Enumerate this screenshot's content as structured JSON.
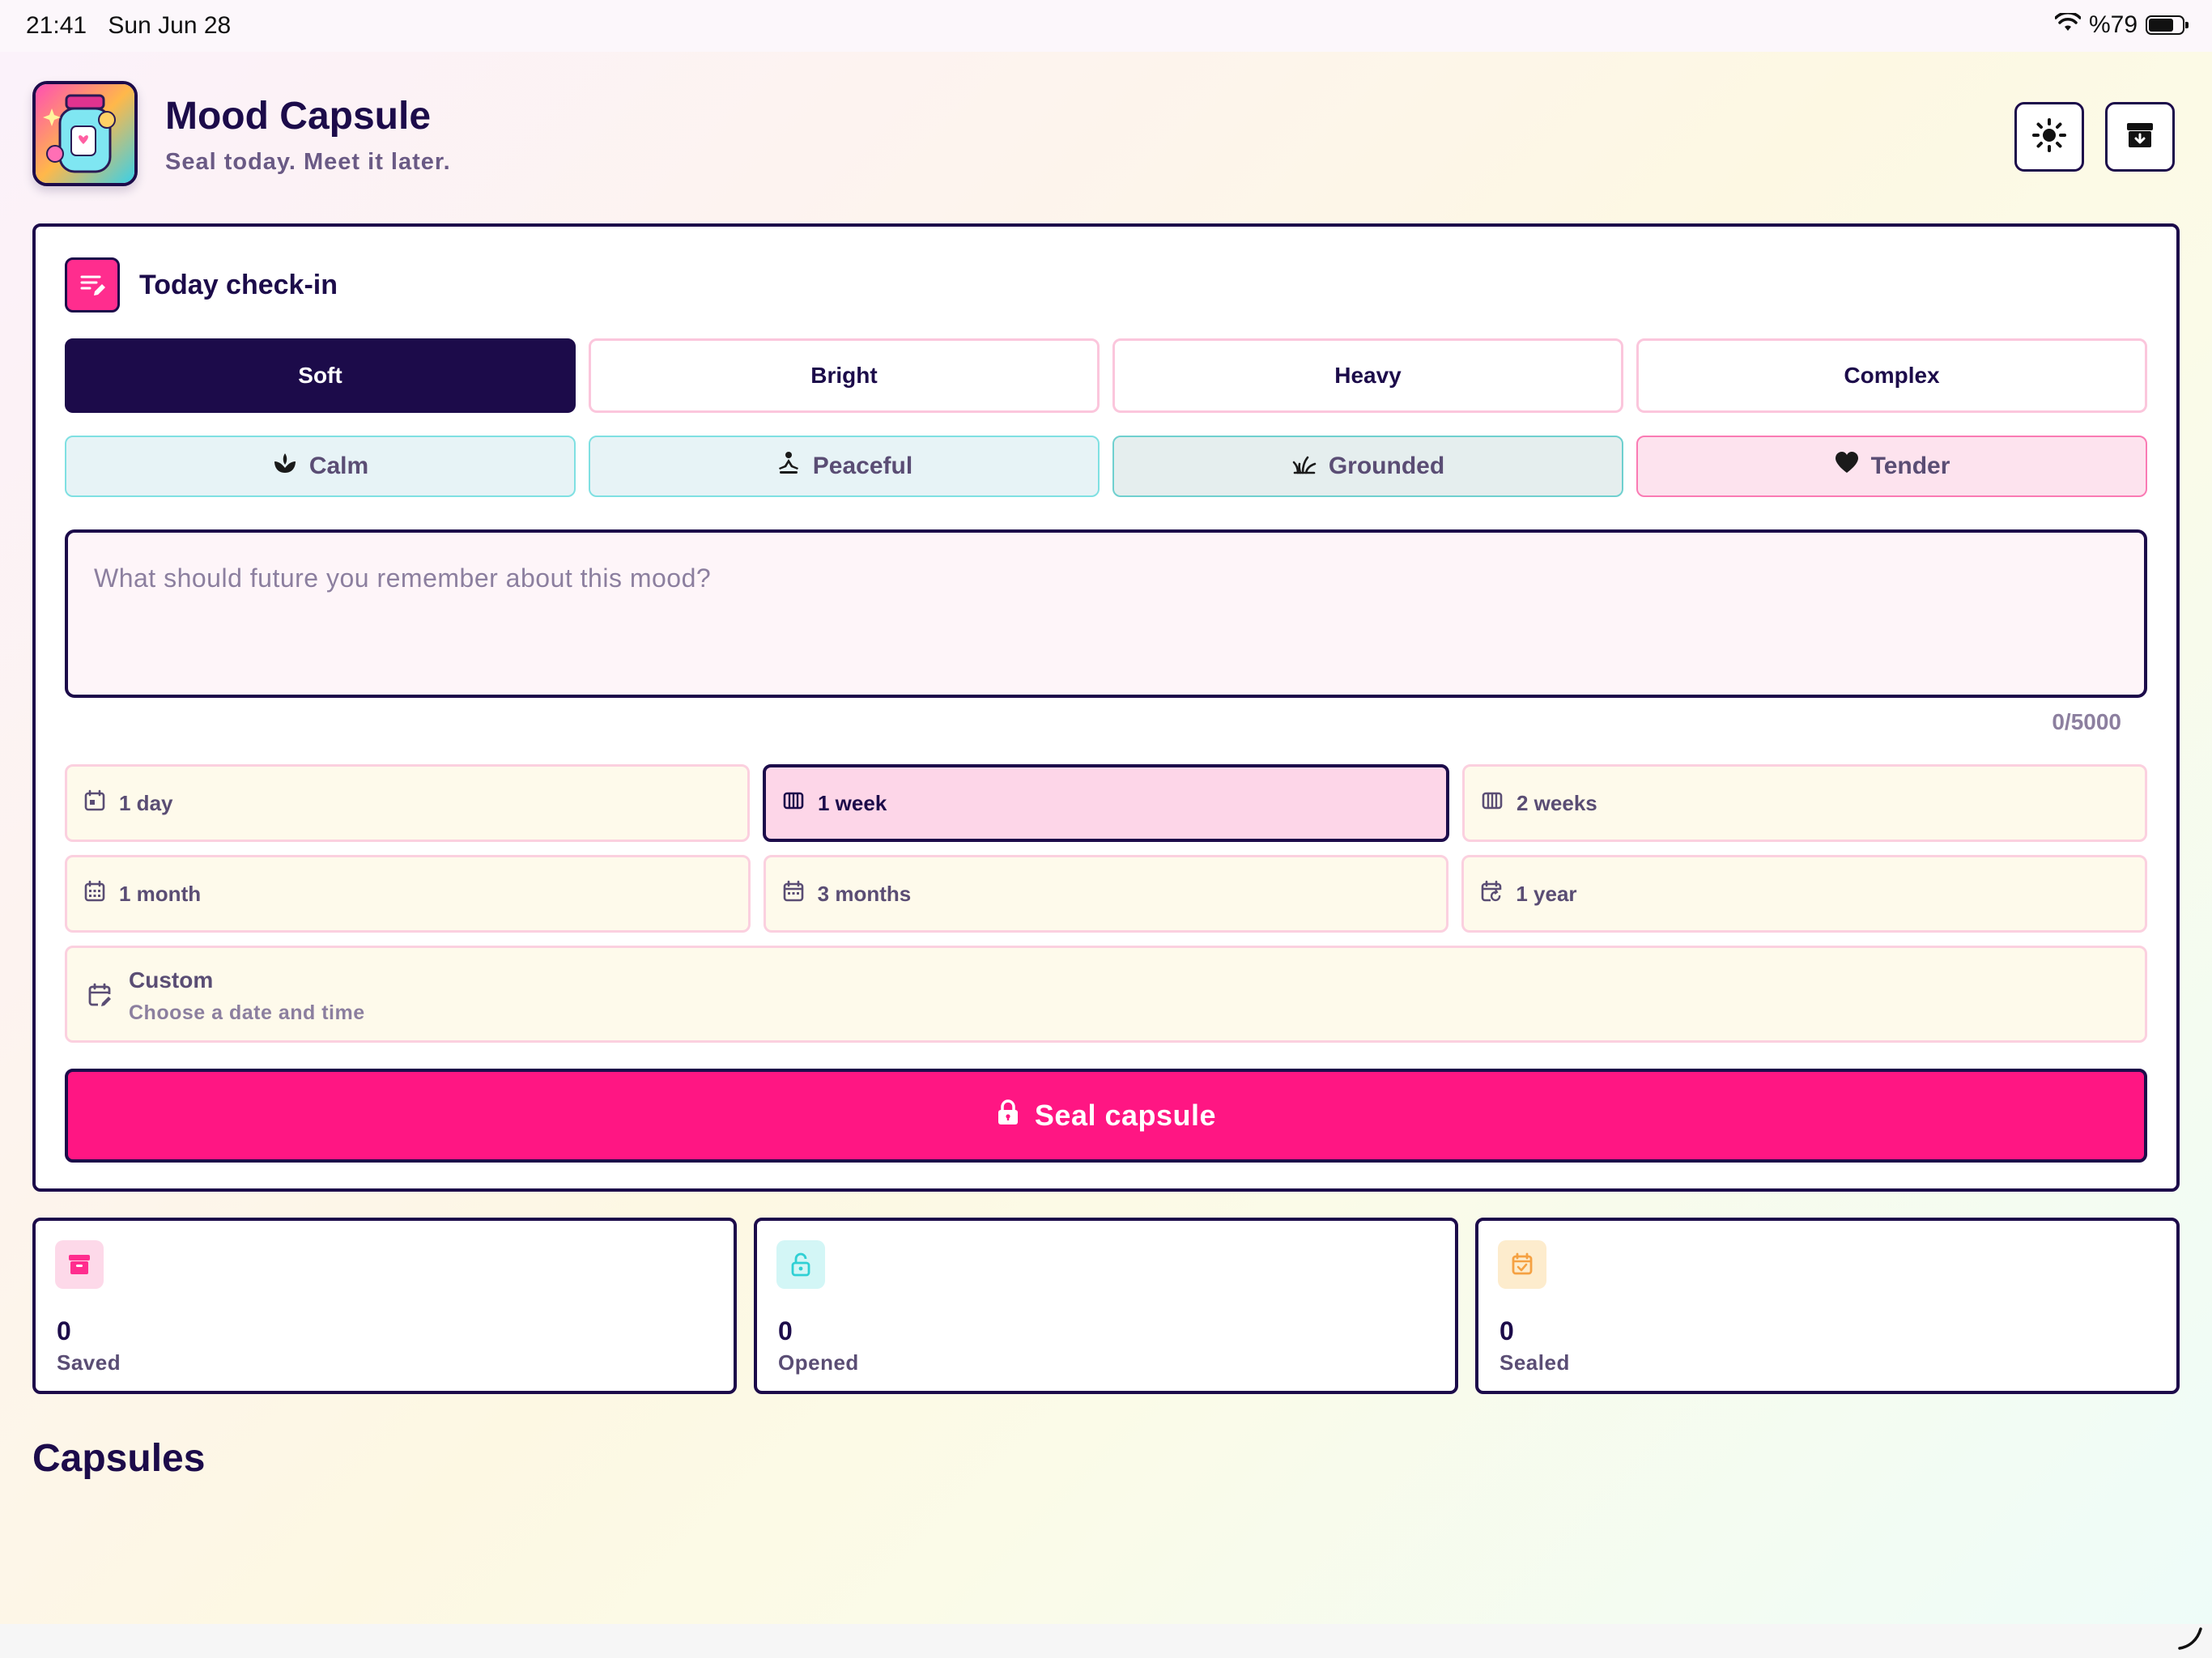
{
  "status_bar": {
    "time": "21:41",
    "date": "Sun Jun 28",
    "battery_text": "%79",
    "battery_level": 0.79
  },
  "header": {
    "title": "Mood Capsule",
    "subtitle": "Seal today. Meet it later.",
    "theme_icon": "sun-icon",
    "archive_icon": "archive-icon"
  },
  "checkin": {
    "title": "Today check-in",
    "categories": [
      {
        "label": "Soft",
        "active": true
      },
      {
        "label": "Bright",
        "active": false
      },
      {
        "label": "Heavy",
        "active": false
      },
      {
        "label": "Complex",
        "active": false
      }
    ],
    "moods": [
      {
        "label": "Calm",
        "icon": "lotus-icon"
      },
      {
        "label": "Peaceful",
        "icon": "meditation-icon"
      },
      {
        "label": "Grounded",
        "icon": "grass-icon"
      },
      {
        "label": "Tender",
        "icon": "heart-icon"
      }
    ],
    "note_placeholder": "What should future you remember about this mood?",
    "char_count": "0/5000",
    "durations": [
      {
        "label": "1 day",
        "icon": "calendar-day-icon",
        "active": false
      },
      {
        "label": "1 week",
        "icon": "calendar-week-icon",
        "active": true
      },
      {
        "label": "2 weeks",
        "icon": "calendar-week-icon",
        "active": false
      },
      {
        "label": "1 month",
        "icon": "calendar-month-icon",
        "active": false
      },
      {
        "label": "3 months",
        "icon": "calendar-icon",
        "active": false
      },
      {
        "label": "1 year",
        "icon": "calendar-refresh-icon",
        "active": false
      }
    ],
    "custom": {
      "label": "Custom",
      "sublabel": "Choose a date and time"
    },
    "seal_label": "Seal capsule"
  },
  "stats": [
    {
      "value": "0",
      "label": "Saved",
      "icon": "archive-icon",
      "color": "#ff2d8e"
    },
    {
      "value": "0",
      "label": "Opened",
      "icon": "lock-open-icon",
      "color": "#2fd0d4"
    },
    {
      "value": "0",
      "label": "Sealed",
      "icon": "calendar-check-icon",
      "color": "#f5a142"
    }
  ],
  "capsules_title": "Capsules",
  "colors": {
    "primary": "#1c0b4a",
    "accent": "#ff1683",
    "muted": "#5a4d74"
  }
}
